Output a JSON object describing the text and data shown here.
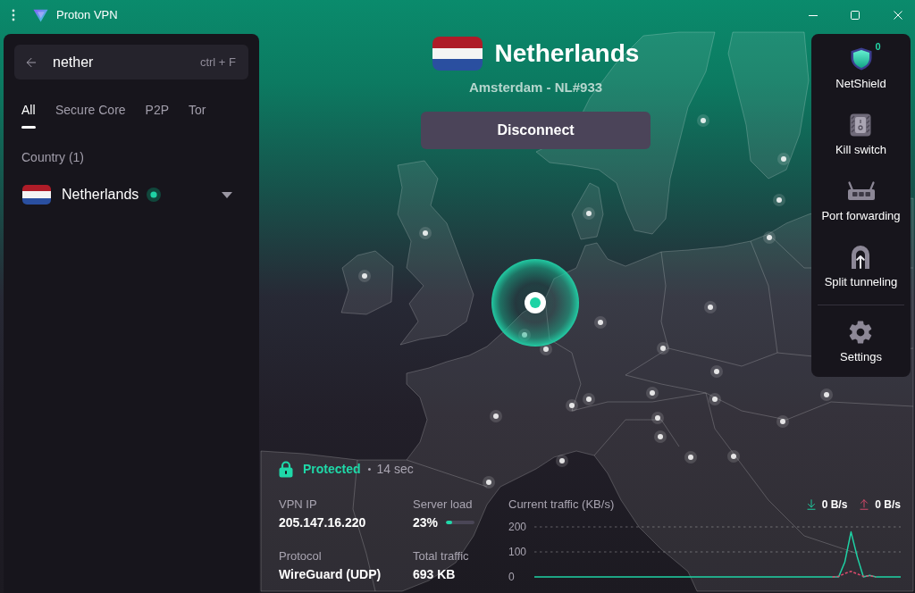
{
  "window": {
    "title": "Proton VPN"
  },
  "search": {
    "value": "nether",
    "shortcut": "ctrl + F"
  },
  "filter_tabs": [
    {
      "label": "All",
      "selected": true
    },
    {
      "label": "Secure Core",
      "selected": false
    },
    {
      "label": "P2P",
      "selected": false
    },
    {
      "label": "Tor",
      "selected": false
    }
  ],
  "results": {
    "heading": "Country (1)",
    "countries": [
      {
        "name": "Netherlands",
        "connected": true,
        "expanded": false
      }
    ]
  },
  "connection": {
    "country": "Netherlands",
    "server": "Amsterdam - NL#933",
    "action": "Disconnect",
    "status": "Protected",
    "separator": "•",
    "duration": "14 sec"
  },
  "features": [
    {
      "kind": "netshield",
      "label": "NetShield",
      "badge": "0"
    },
    {
      "kind": "kill_switch",
      "label": "Kill switch"
    },
    {
      "kind": "port_forwarding",
      "label": "Port forwarding"
    },
    {
      "kind": "split_tunneling",
      "label": "Split tunneling"
    },
    {
      "kind": "settings",
      "label": "Settings"
    }
  ],
  "stats": [
    {
      "kind": "text",
      "label": "VPN IP",
      "value": "205.147.16.220"
    },
    {
      "kind": "meter",
      "label": "Server load",
      "value": "23%",
      "level": 0.23
    },
    {
      "kind": "text",
      "label": "Protocol",
      "value": "WireGuard (UDP)"
    },
    {
      "kind": "text",
      "label": "Total traffic",
      "value": "693 KB"
    }
  ],
  "traffic": {
    "download": "0 B/s",
    "upload": "0 B/s",
    "chart_data": {
      "type": "line",
      "title": "Current traffic (KB/s)",
      "ylim": [
        0,
        200
      ],
      "yticks": [
        0,
        100,
        200
      ],
      "series": [
        {
          "color": "#1ed3a5",
          "line_style": "solid",
          "values": [
            0,
            0,
            0,
            0,
            0,
            0,
            0,
            0,
            0,
            0,
            0,
            0,
            0,
            0,
            0,
            0,
            0,
            0,
            0,
            0,
            0,
            0,
            0,
            0,
            0,
            0,
            0,
            0,
            0,
            0,
            0,
            0,
            0,
            0,
            0,
            0,
            0,
            0,
            0,
            0,
            0,
            0,
            0,
            0,
            0,
            0,
            0,
            0,
            0,
            0,
            60,
            180,
            80,
            0,
            6,
            0,
            0,
            0,
            0,
            0
          ]
        },
        {
          "color": "#dd4a6d",
          "line_style": "dashed",
          "values": [
            null,
            null,
            null,
            null,
            null,
            null,
            null,
            null,
            null,
            null,
            null,
            null,
            null,
            null,
            null,
            null,
            null,
            null,
            null,
            null,
            null,
            null,
            null,
            null,
            null,
            null,
            null,
            null,
            null,
            null,
            null,
            null,
            null,
            null,
            null,
            null,
            null,
            null,
            null,
            null,
            null,
            null,
            null,
            null,
            null,
            null,
            null,
            null,
            0,
            2,
            14,
            22,
            12,
            2,
            5,
            0,
            null,
            null,
            null,
            null
          ]
        }
      ]
    }
  }
}
